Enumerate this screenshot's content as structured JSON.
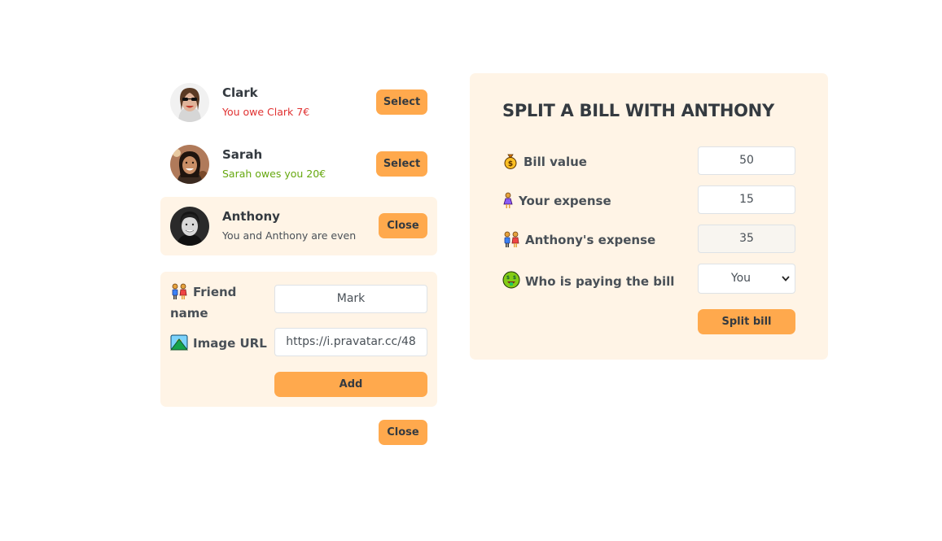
{
  "friends": [
    {
      "name": "Clark",
      "status": "You owe Clark 7€",
      "status_type": "red",
      "button": "Select"
    },
    {
      "name": "Sarah",
      "status": "Sarah owes you 20€",
      "status_type": "green",
      "button": "Select"
    },
    {
      "name": "Anthony",
      "status": "You and Anthony are even",
      "status_type": "neutral",
      "button": "Close",
      "selected": true
    }
  ],
  "add_form": {
    "friend_name_label": "Friend name",
    "friend_name_value": "Mark",
    "image_url_label": "Image URL",
    "image_url_value": "https://i.pravatar.cc/48",
    "add_button": "Add"
  },
  "close_form_button": "Close",
  "split": {
    "title": "SPLIT A BILL WITH ANTHONY",
    "bill_label": "Bill value",
    "bill_value": "50",
    "your_expense_label": "Your expense",
    "your_expense_value": "15",
    "friend_expense_label": "Anthony's expense",
    "friend_expense_value": "35",
    "payer_label": "Who is paying the bill",
    "payer_value": "You",
    "split_button": "Split bill"
  },
  "colors": {
    "accent": "#ffa94d",
    "panel": "#fff4e6",
    "red": "#e03131",
    "green": "#66a80f"
  }
}
